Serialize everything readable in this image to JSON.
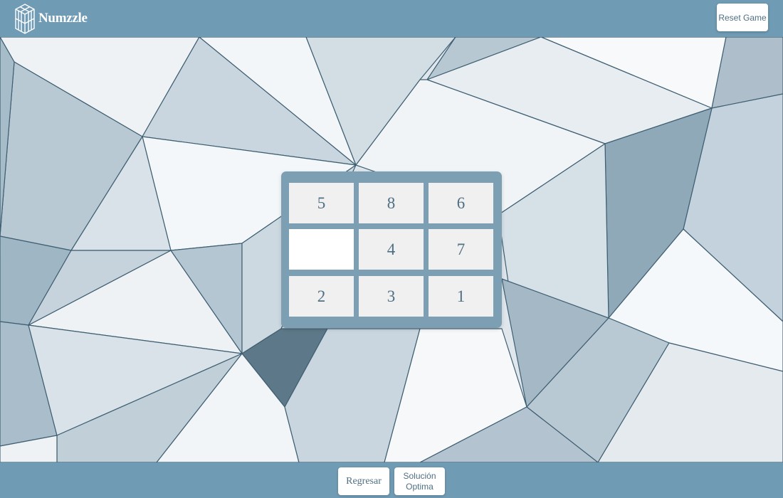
{
  "app": {
    "title": "Numzzle"
  },
  "header": {
    "logo_icon": "cube-logo-icon",
    "reset_label": "Reset Game"
  },
  "board": {
    "rows": 3,
    "cols": 3,
    "tiles": [
      "5",
      "8",
      "6",
      "",
      "4",
      "7",
      "2",
      "3",
      "1"
    ]
  },
  "footer": {
    "back_label": "Regresar",
    "solution_line1": "Solución",
    "solution_line2": "Optima"
  },
  "colors": {
    "bar": "#6f9bb4",
    "board_frame": "#7d9fb3",
    "tile": "#f0f0f0",
    "empty_tile": "#ffffff",
    "tile_text": "#4f6f83"
  }
}
